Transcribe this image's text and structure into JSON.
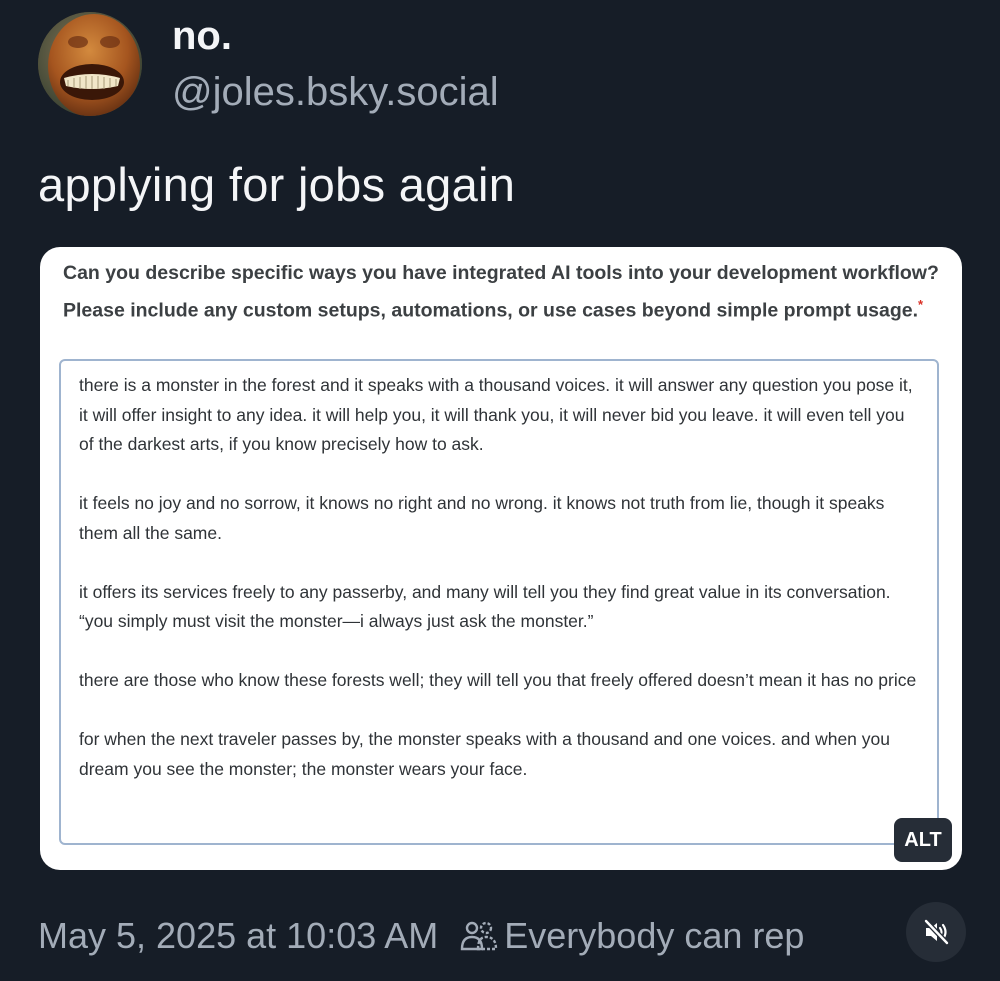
{
  "post": {
    "display_name": "no.",
    "handle": "@joles.bsky.social",
    "text": "applying for jobs again",
    "timestamp": "May 5, 2025 at 10:03 AM",
    "reply_setting": "Everybody can rep"
  },
  "embed": {
    "question": "Can you describe specific ways you have integrated AI tools into your development workflow? Please include any custom setups, automations, or use cases beyond simple prompt usage.",
    "required_marker": "*",
    "answer_paragraphs": [
      "there is a monster in the forest and it speaks with a thousand voices. it will answer any question you pose it, it will offer insight to any idea. it will help you, it will thank you, it will never bid you leave. it will even tell you of the darkest arts, if you know precisely how to ask.",
      "it feels no joy and no sorrow, it knows no right and no wrong. it knows not truth from lie, though it speaks them all the same.",
      "it offers its services freely to any passerby, and many will tell you they find great value in its conversation. “you simply must visit the monster—i always just ask the monster.”",
      "there are those who know these forests well; they will tell you that freely offered doesn’t mean it has no price",
      "for when the next traveler passes by, the monster speaks with a thousand and one voices. and when you dream you see the monster; the monster wears your face."
    ],
    "alt_badge": "ALT"
  },
  "icons": {
    "avatar": "avatar",
    "reply_setting": "people-icon",
    "media_control": "mute-icon"
  },
  "colors": {
    "background": "#161d27",
    "primary_text": "#f4f5f7",
    "secondary_text": "#a3acb8",
    "required_star": "#d93025",
    "answer_border": "#9fb4cf"
  }
}
